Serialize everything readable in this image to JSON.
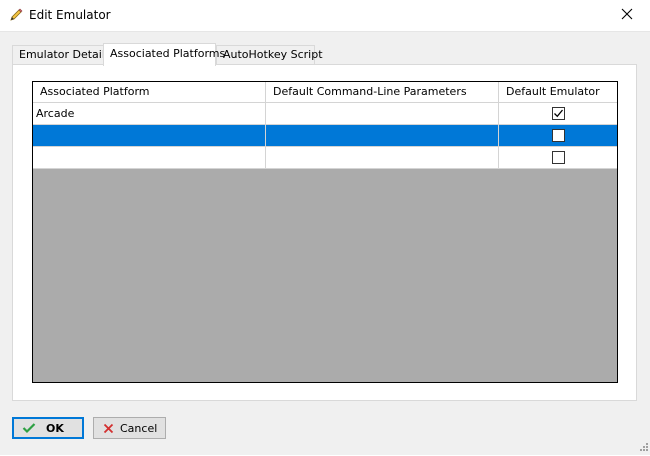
{
  "window": {
    "title": "Edit Emulator"
  },
  "tabs": [
    {
      "label": "Emulator Details",
      "active": false
    },
    {
      "label": "Associated Platforms",
      "active": true
    },
    {
      "label": "AutoHotkey Script",
      "active": false
    }
  ],
  "grid": {
    "columns": [
      "Associated Platform",
      "Default Command-Line Parameters",
      "Default Emulator"
    ],
    "rows": [
      {
        "platform": "Arcade",
        "params": "",
        "default_emulator": true,
        "selected": false
      },
      {
        "platform": "",
        "params": "",
        "default_emulator": false,
        "selected": true
      },
      {
        "platform": "",
        "params": "",
        "default_emulator": false,
        "selected": false
      }
    ]
  },
  "buttons": {
    "ok_label": "OK",
    "cancel_label": "Cancel"
  },
  "colors": {
    "selection": "#0078d7",
    "empty_area": "#ababab",
    "ok_icon": "#2ea043",
    "cancel_icon": "#d32f2f"
  },
  "icons": {
    "title": "pencil-icon",
    "close": "close-icon",
    "ok": "checkmark-icon",
    "cancel": "x-icon"
  }
}
